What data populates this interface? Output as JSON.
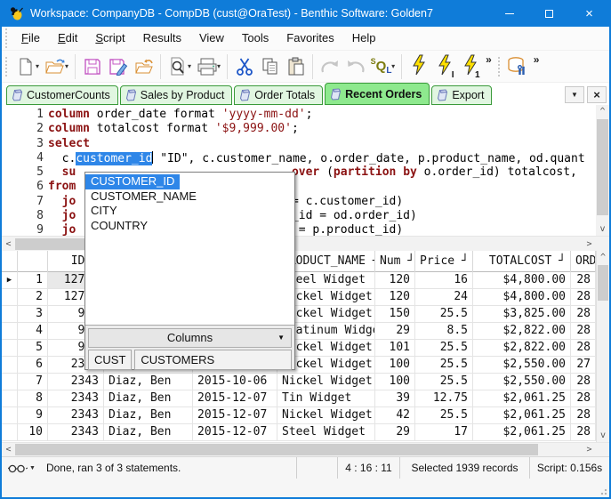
{
  "window": {
    "title": "Workspace: CompanyDB - CompDB (cust@OraTest) - Benthic Software: Golden7"
  },
  "ui": {
    "caret_down": "▾",
    "menu_caret": "▼",
    "overflow": "»",
    "close": "×",
    "scroll_up": "^",
    "scroll_down": "v",
    "scroll_left": "<",
    "scroll_right": ">"
  },
  "menu": {
    "items": [
      {
        "label": "File",
        "u": true
      },
      {
        "label": "Edit",
        "u": true
      },
      {
        "label": "Script",
        "u": true
      },
      {
        "label": "Results",
        "u": false
      },
      {
        "label": "View",
        "u": false
      },
      {
        "label": "Tools",
        "u": false
      },
      {
        "label": "Favorites",
        "u": false
      },
      {
        "label": "Help",
        "u": false
      }
    ]
  },
  "toolbar": {
    "sql_s": "S",
    "sql_q": "Q",
    "sql_l": "L",
    "bolt_i": "I",
    "bolt_1": "1"
  },
  "tabs": {
    "items": [
      {
        "label": "CustomerCounts",
        "active": false
      },
      {
        "label": "Sales by Product",
        "active": false
      },
      {
        "label": "Order Totals",
        "active": false
      },
      {
        "label": "Recent Orders",
        "active": true
      },
      {
        "label": "Export",
        "active": false
      }
    ]
  },
  "editor": {
    "lines": [
      {
        "n": "1",
        "segs": [
          {
            "t": "column",
            "s": "kw"
          },
          {
            "t": " order_date format ",
            "s": "p"
          },
          {
            "t": "'yyyy-mm-dd'",
            "s": "str"
          },
          {
            "t": ";",
            "s": "p"
          }
        ]
      },
      {
        "n": "2",
        "segs": [
          {
            "t": "column",
            "s": "kw"
          },
          {
            "t": " totalcost format ",
            "s": "p"
          },
          {
            "t": "'$9,999.00'",
            "s": "str"
          },
          {
            "t": ";",
            "s": "p"
          }
        ]
      },
      {
        "n": "3",
        "segs": [
          {
            "t": "select",
            "s": "kw"
          }
        ]
      },
      {
        "n": "4",
        "segs": [
          {
            "t": "  c.",
            "s": "p"
          },
          {
            "t": "customer_id",
            "s": "sel"
          },
          {
            "t": " \"ID\", c.customer_name, o.order_date, p.product_name, od.quant",
            "s": "p"
          }
        ]
      },
      {
        "n": "5",
        "segs": [
          {
            "t": "  ",
            "s": "p"
          },
          {
            "t": "su",
            "s": "kw"
          },
          {
            "t": "                               ",
            "s": "p"
          },
          {
            "t": "over",
            "s": "kw"
          },
          {
            "t": " (",
            "s": "p"
          },
          {
            "t": "partition by",
            "s": "kw"
          },
          {
            "t": " o.order_id) totalcost,",
            "s": "p"
          }
        ]
      },
      {
        "n": "6",
        "segs": [
          {
            "t": "from",
            "s": "kw"
          }
        ]
      },
      {
        "n": "7",
        "segs": [
          {
            "t": "  ",
            "s": "p"
          },
          {
            "t": "jo",
            "s": "kw"
          },
          {
            "t": "                               ",
            "s": "p"
          },
          {
            "t": "= c.customer_id)",
            "s": "p"
          }
        ]
      },
      {
        "n": "8",
        "segs": [
          {
            "t": "  ",
            "s": "p"
          },
          {
            "t": "jo",
            "s": "kw"
          },
          {
            "t": "                              ",
            "s": "p"
          },
          {
            "t": "r_id = od.order_id)",
            "s": "p"
          }
        ]
      },
      {
        "n": "9",
        "segs": [
          {
            "t": "  ",
            "s": "p"
          },
          {
            "t": "jo",
            "s": "kw"
          },
          {
            "t": "                              ",
            "s": "p"
          },
          {
            "t": "d = p.product_id)",
            "s": "p"
          }
        ]
      }
    ]
  },
  "popup": {
    "items": [
      "CUSTOMER_ID",
      "CUSTOMER_NAME",
      "CITY",
      "COUNTRY"
    ],
    "selected": "CUSTOMER_ID",
    "dropdown": "Columns",
    "buttons": [
      "CUST",
      "CUSTOMERS"
    ]
  },
  "grid": {
    "marker_glyph": "▶",
    "grip_glyph": "┘",
    "headers": [
      {
        "label": "",
        "grip": false
      },
      {
        "label": "",
        "grip": false
      },
      {
        "label": "ID",
        "grip": true
      },
      {
        "label": "",
        "grip": false
      },
      {
        "label": "",
        "grip": false
      },
      {
        "label": "PRODUCT_NAME",
        "grip": true
      },
      {
        "label": "Num",
        "grip": true
      },
      {
        "label": "Price",
        "grip": true
      },
      {
        "label": "TOTALCOST",
        "grip": true
      },
      {
        "label": "ORDER_I",
        "grip": false
      }
    ],
    "rows": [
      {
        "marker": true,
        "n": "1",
        "id": "12790",
        "name": "",
        "date": "",
        "product": "Steel Widget",
        "num": "120",
        "price": "16",
        "total": "$4,800.00",
        "order": "28"
      },
      {
        "marker": false,
        "n": "2",
        "id": "12790",
        "name": "",
        "date": "",
        "product": "Nickel Widget",
        "num": "120",
        "price": "24",
        "total": "$4,800.00",
        "order": "28"
      },
      {
        "marker": false,
        "n": "3",
        "id": "973",
        "name": "",
        "date": "",
        "product": "Nickel Widget",
        "num": "150",
        "price": "25.5",
        "total": "$3,825.00",
        "order": "28"
      },
      {
        "marker": false,
        "n": "4",
        "id": "973",
        "name": "",
        "date": "",
        "product": "Platinum Widget",
        "num": "29",
        "price": "8.5",
        "total": "$2,822.00",
        "order": "28"
      },
      {
        "marker": false,
        "n": "5",
        "id": "973",
        "name": "",
        "date": "",
        "product": "Nickel Widget",
        "num": "101",
        "price": "25.5",
        "total": "$2,822.00",
        "order": "28"
      },
      {
        "marker": false,
        "n": "6",
        "id": "2343",
        "name": "",
        "date": "",
        "product": "Nickel Widget",
        "num": "100",
        "price": "25.5",
        "total": "$2,550.00",
        "order": "27"
      },
      {
        "marker": false,
        "n": "7",
        "id": "2343",
        "name": "Diaz, Ben",
        "date": "2015-10-06",
        "product": "Nickel Widget",
        "num": "100",
        "price": "25.5",
        "total": "$2,550.00",
        "order": "28"
      },
      {
        "marker": false,
        "n": "8",
        "id": "2343",
        "name": "Diaz, Ben",
        "date": "2015-12-07",
        "product": "Tin Widget",
        "num": "39",
        "price": "12.75",
        "total": "$2,061.25",
        "order": "28"
      },
      {
        "marker": false,
        "n": "9",
        "id": "2343",
        "name": "Diaz, Ben",
        "date": "2015-12-07",
        "product": "Nickel Widget",
        "num": "42",
        "price": "25.5",
        "total": "$2,061.25",
        "order": "28"
      },
      {
        "marker": false,
        "n": "10",
        "id": "2343",
        "name": "Diaz, Ben",
        "date": "2015-12-07",
        "product": "Steel Widget",
        "num": "29",
        "price": "17",
        "total": "$2,061.25",
        "order": "28"
      }
    ]
  },
  "statusbar": {
    "segments": [
      "Done, ran 3 of 3 statements.",
      "",
      "4 : 16 : 11",
      "Selected 1939 records",
      "Script: 0.156s"
    ]
  }
}
